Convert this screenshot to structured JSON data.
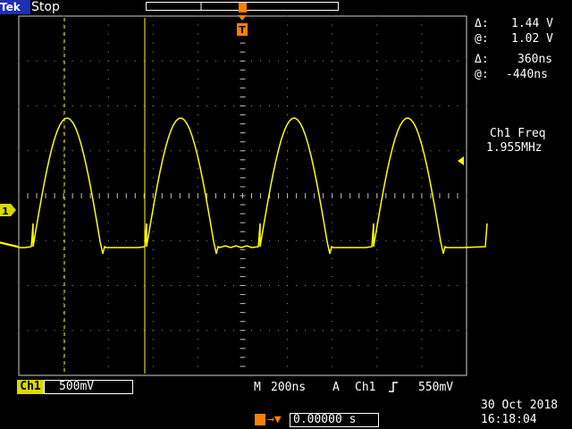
{
  "header": {
    "brand": "Tek",
    "run_status": "Stop"
  },
  "trigger_marker": "T",
  "channel_marker": "1",
  "cursor_readouts": {
    "voltage_delta_label": "Δ:",
    "voltage_delta_value": "1.44 V",
    "voltage_at_label": "@:",
    "voltage_at_value": "1.02 V",
    "time_delta_label": "Δ:",
    "time_delta_value": "360ns",
    "time_at_label": "@:",
    "time_at_value": "-440ns"
  },
  "measurement": {
    "label": "Ch1 Freq",
    "value": "1.955MHz"
  },
  "bottom": {
    "ch1_label": "Ch1",
    "ch1_scale": "500mV",
    "timebase_label": "M",
    "timebase_value": "200ns",
    "trigger_mode": "A",
    "trigger_source": "Ch1",
    "trigger_slope_icon": "rising-edge-icon",
    "trigger_level": "550mV",
    "trigger_delay_value": "0.00000 s",
    "date": "30 Oct 2018",
    "time": "16:18:04"
  },
  "colors": {
    "trace": "#ffff00",
    "graticule": "#d0d0d0",
    "trigger_marker": "#ff8000",
    "brand_bg": "#1e2fb0"
  }
}
